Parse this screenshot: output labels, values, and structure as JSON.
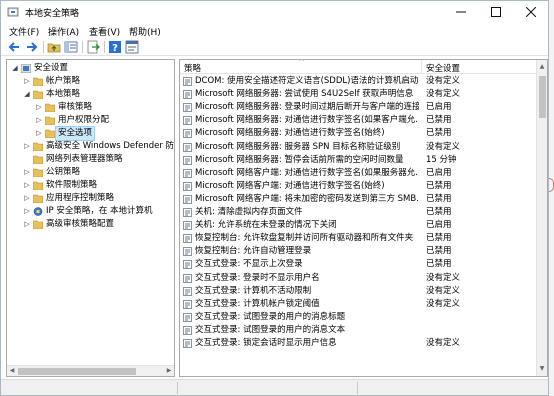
{
  "window": {
    "title": "本地安全策略",
    "controls": {
      "minimize": "minimize-icon",
      "maximize": "maximize-icon",
      "close": "close-icon"
    }
  },
  "menu": [
    "文件(F)",
    "操作(A)",
    "查看(V)",
    "帮助(H)"
  ],
  "toolbar": [
    "back-icon",
    "forward-icon",
    "up-folder-icon",
    "show-hide-tree-icon",
    "export-list-icon",
    "help-icon",
    "properties-icon"
  ],
  "tree": [
    {
      "label": "安全设置",
      "level": 0,
      "expanded": true,
      "icon": "security-settings-icon"
    },
    {
      "label": "帐户策略",
      "level": 1,
      "expanded": false,
      "icon": "folder-icon"
    },
    {
      "label": "本地策略",
      "level": 1,
      "expanded": true,
      "icon": "folder-icon"
    },
    {
      "label": "审核策略",
      "level": 2,
      "expanded": false,
      "icon": "folder-icon"
    },
    {
      "label": "用户权限分配",
      "level": 2,
      "expanded": false,
      "icon": "folder-icon"
    },
    {
      "label": "安全选项",
      "level": 2,
      "expanded": false,
      "icon": "folder-icon",
      "selected": true
    },
    {
      "label": "高级安全 Windows Defender 防火墙",
      "level": 1,
      "expanded": false,
      "icon": "folder-icon"
    },
    {
      "label": "网络列表管理器策略",
      "level": 1,
      "expanded": null,
      "icon": "folder-icon"
    },
    {
      "label": "公钥策略",
      "level": 1,
      "expanded": false,
      "icon": "folder-icon"
    },
    {
      "label": "软件限制策略",
      "level": 1,
      "expanded": false,
      "icon": "folder-icon"
    },
    {
      "label": "应用程序控制策略",
      "level": 1,
      "expanded": false,
      "icon": "folder-icon"
    },
    {
      "label": "IP 安全策略，在 本地计算机",
      "level": 1,
      "expanded": false,
      "icon": "ip-security-icon"
    },
    {
      "label": "高级审核策略配置",
      "level": 1,
      "expanded": false,
      "icon": "folder-icon"
    }
  ],
  "list": {
    "columns": [
      "策略",
      "安全设置"
    ],
    "rows": [
      {
        "policy": "DCOM: 使用安全描述符定义语言(SDDL)语法的计算机启动...",
        "setting": "没有定义"
      },
      {
        "policy": "Microsoft 网络服务器: 尝试使用 S4U2Self 获取声明信息",
        "setting": "没有定义"
      },
      {
        "policy": "Microsoft 网络服务器: 登录时间过期后断开与客户端的连接",
        "setting": "已启用"
      },
      {
        "policy": "Microsoft 网络服务器: 对通信进行数字签名(如果客户端允...",
        "setting": "已禁用"
      },
      {
        "policy": "Microsoft 网络服务器: 对通信进行数字签名(始终)",
        "setting": "已禁用"
      },
      {
        "policy": "Microsoft 网络服务器: 服务器 SPN 目标名称验证级别",
        "setting": "没有定义"
      },
      {
        "policy": "Microsoft 网络服务器: 暂停会话前所需的空闲时间数量",
        "setting": "15 分钟"
      },
      {
        "policy": "Microsoft 网络客户端: 对通信进行数字签名(如果服务器允...",
        "setting": "已启用"
      },
      {
        "policy": "Microsoft 网络客户端: 对通信进行数字签名(始终)",
        "setting": "已禁用"
      },
      {
        "policy": "Microsoft 网络客户端: 将未加密的密码发送到第三方 SMB...",
        "setting": "已禁用"
      },
      {
        "policy": "关机: 清除虚拟内存页面文件",
        "setting": "已禁用"
      },
      {
        "policy": "关机: 允许系统在未登录的情况下关闭",
        "setting": "已启用"
      },
      {
        "policy": "恢复控制台: 允许软盘复制并访问所有驱动器和所有文件夹",
        "setting": "已禁用"
      },
      {
        "policy": "恢复控制台: 允许自动管理登录",
        "setting": "已禁用"
      },
      {
        "policy": "交互式登录: 不显示上次登录",
        "setting": "已禁用"
      },
      {
        "policy": "交互式登录: 登录时不显示用户名",
        "setting": "没有定义"
      },
      {
        "policy": "交互式登录: 计算机不活动限制",
        "setting": "没有定义"
      },
      {
        "policy": "交互式登录: 计算机帐户锁定阈值",
        "setting": "没有定义"
      },
      {
        "policy": "交互式登录: 试图登录的用户的消息标题",
        "setting": ""
      },
      {
        "policy": "交互式登录: 试图登录的用户的消息文本",
        "setting": ""
      },
      {
        "policy": "交互式登录: 锁定会话时显示用户信息",
        "setting": "没有定义"
      }
    ]
  },
  "colors": {
    "selection": "#cce8ff",
    "folder": "#e8c05a",
    "policy_icon": "#6b7a8f"
  }
}
